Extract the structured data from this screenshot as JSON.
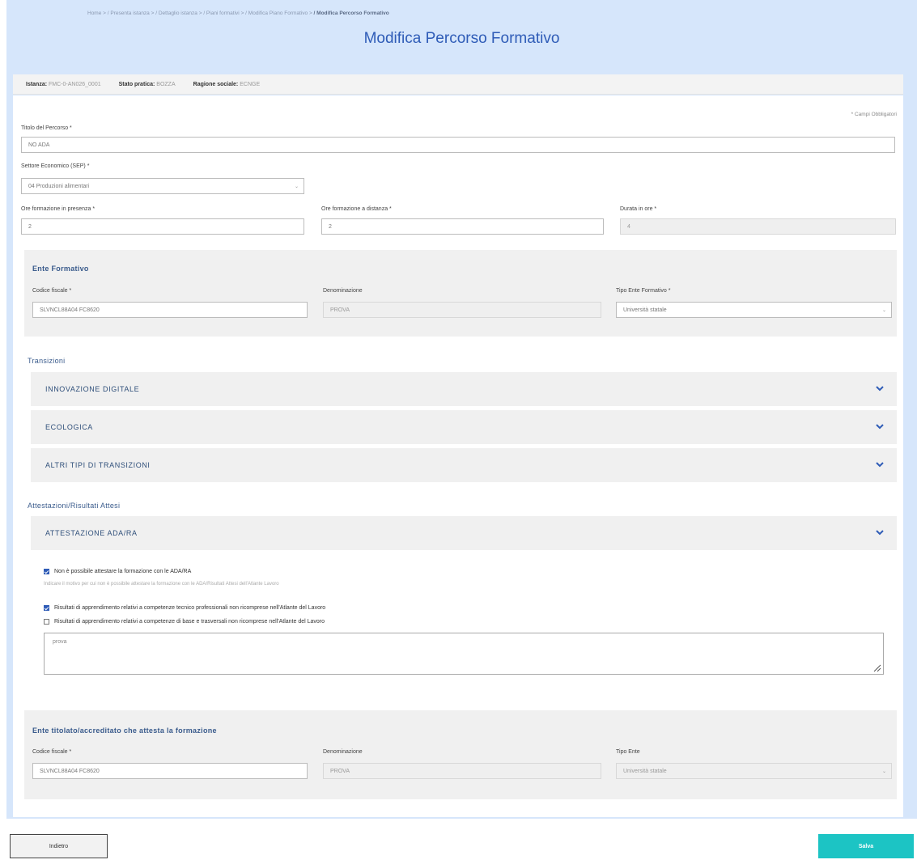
{
  "breadcrumb": {
    "items": [
      "Home",
      "/ Presenta istanza",
      "/ Dettaglio istanza",
      "/ Piani formativi",
      "/ Modifica Piano Formativo"
    ],
    "separator": ">",
    "current": "/ Modifica Percorso Formativo"
  },
  "page_title": "Modifica Percorso Formativo",
  "infobar": {
    "istanza_label": "Istanza:",
    "istanza_value": "FMC-0-AN026_0001",
    "stato_label": "Stato pratica:",
    "stato_value": "BOZZA",
    "ragione_label": "Ragione sociale:",
    "ragione_value": "ECNGE"
  },
  "form": {
    "required_note": "* Campi Obbligatori",
    "titolo_label": "Titolo del Percorso *",
    "titolo_value": "NO ADA",
    "settore_label": "Settore Economico (SEP) *",
    "settore_value": "04 Produzioni alimentari",
    "ore_presenza_label": "Ore formazione in presenza *",
    "ore_presenza_value": "2",
    "ore_distanza_label": "Ore formazione a distanza *",
    "ore_distanza_value": "2",
    "durata_label": "Durata in ore *",
    "durata_value": "4"
  },
  "ente_formativo": {
    "title": "Ente Formativo",
    "cf_label": "Codice fiscale *",
    "cf_value": "SLVNCL88A04 FC8620",
    "den_label": "Denominazione",
    "den_value": "PROVA",
    "tipo_label": "Tipo Ente Formativo *",
    "tipo_value": "Università statale"
  },
  "transizioni": {
    "title": "Transizioni",
    "items": [
      "INNOVAZIONE DIGITALE",
      "ECOLOGICA",
      "ALTRI TIPI DI TRANSIZIONI"
    ]
  },
  "attestazioni": {
    "title": "Attestazioni/Risultati Attesi",
    "accordion": "ATTESTAZIONE ADA/RA",
    "non_possibile": "Non è possibile attestare la formazione con le ADA/RA",
    "hint": "Indicare il motivo per cui non è possibile attestare la formazione con le ADA/Risultati Attesi dell'Atlante Lavoro",
    "opt1": "Risultati di apprendimento relativi a competenze tecnico professionali non ricomprese nell'Atlante del Lavoro",
    "opt2": "Risultati di apprendimento relativi a competenze di base e trasversali non ricomprese nell'Atlante del Lavoro",
    "textarea_value": "prova"
  },
  "ente_titolato": {
    "title": "Ente titolato/accreditato che attesta la formazione",
    "cf_label": "Codice fiscale *",
    "cf_value": "SLVNCL88A04 FC8620",
    "den_label": "Denominazione",
    "den_value": "PROVA",
    "tipo_label": "Tipo Ente",
    "tipo_value": "Università statale"
  },
  "buttons": {
    "back": "Indietro",
    "save": "Salva"
  },
  "colors": {
    "accent": "#2f5cb7",
    "save": "#1cc4c4",
    "frame": "#d6e6fb"
  }
}
